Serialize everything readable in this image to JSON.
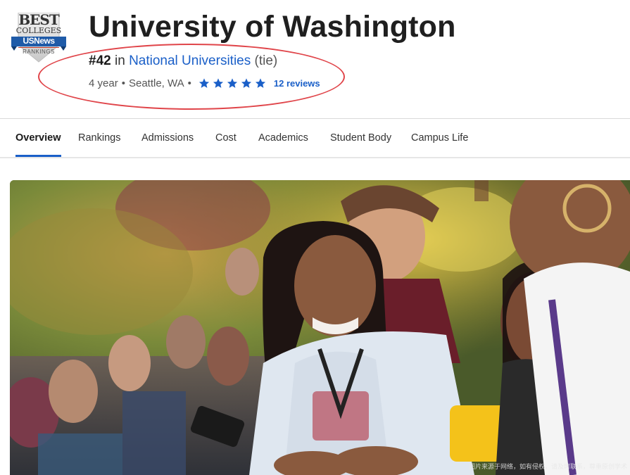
{
  "badge": {
    "best": "BEST",
    "colleges": "COLLEGES",
    "brand": "USNews",
    "rankings": "RANKINGS"
  },
  "school": {
    "name": "University of Washington",
    "rank": "#42",
    "rank_in": "in",
    "rank_category": "National Universities",
    "tie": "(tie)",
    "type": "4 year",
    "location": "Seattle, WA",
    "rating_stars": 5,
    "reviews": "12 reviews"
  },
  "tabs": [
    {
      "label": "Overview",
      "active": true
    },
    {
      "label": "Rankings",
      "active": false
    },
    {
      "label": "Admissions",
      "active": false
    },
    {
      "label": "Cost",
      "active": false
    },
    {
      "label": "Academics",
      "active": false
    },
    {
      "label": "Student Body",
      "active": false
    },
    {
      "label": "Campus Life",
      "active": false
    }
  ],
  "hero": {
    "caption": "图片来源于网络，如有侵权，请及时联系，尊重原创学术"
  },
  "colors": {
    "accent": "#1a5fc8",
    "annotation": "#e0454a",
    "star": "#1a5fc8"
  },
  "icons": {
    "star": "star-icon"
  }
}
